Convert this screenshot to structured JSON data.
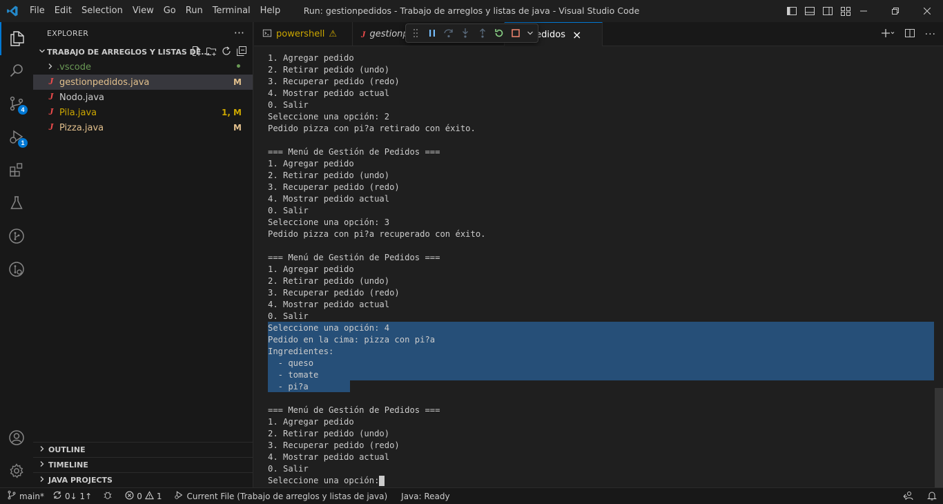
{
  "titlebar": {
    "menu": [
      "File",
      "Edit",
      "Selection",
      "View",
      "Go",
      "Run",
      "Terminal",
      "Help"
    ],
    "title": "Run: gestionpedidos - Trabajo de arreglos y listas de java - Visual Studio Code"
  },
  "activitybar": {
    "source_control_badge": "4",
    "run_debug_badge": "1"
  },
  "explorer": {
    "header": "EXPLORER",
    "folder_name": "TRABAJO DE ARREGLOS Y LISTAS DE...",
    "files": [
      {
        "icon": "J",
        "name": ".vscode",
        "status": "•",
        "kind": "folder",
        "color": "#6a9955"
      },
      {
        "icon": "J",
        "name": "gestionpedidos.java",
        "status": "M",
        "kind": "java",
        "color": "#e2c08d"
      },
      {
        "icon": "J",
        "name": "Nodo.java",
        "status": "",
        "kind": "java",
        "color": "#cccccc"
      },
      {
        "icon": "J",
        "name": "Pila.java",
        "status": "1, M",
        "kind": "java",
        "color": "#cca700"
      },
      {
        "icon": "J",
        "name": "Pizza.java",
        "status": "M",
        "kind": "java",
        "color": "#e2c08d"
      }
    ],
    "sections": [
      "OUTLINE",
      "TIMELINE",
      "JAVA PROJECTS"
    ]
  },
  "tabs": {
    "items": [
      {
        "label": "powershell",
        "warning": "⚠"
      },
      {
        "label": "gestionp",
        "icon": "J"
      },
      {
        "label": "tionpedidos",
        "close": "×"
      }
    ]
  },
  "terminal": {
    "lines": [
      "1. Agregar pedido",
      "2. Retirar pedido (undo)",
      "3. Recuperar pedido (redo)",
      "4. Mostrar pedido actual",
      "0. Salir",
      "Seleccione una opción: 2",
      "Pedido pizza con pi?a retirado con éxito.",
      "",
      "=== Menú de Gestión de Pedidos ===",
      "1. Agregar pedido",
      "2. Retirar pedido (undo)",
      "3. Recuperar pedido (redo)",
      "4. Mostrar pedido actual",
      "0. Salir",
      "Seleccione una opción: 3",
      "Pedido pizza con pi?a recuperado con éxito.",
      "",
      "=== Menú de Gestión de Pedidos ===",
      "1. Agregar pedido",
      "2. Retirar pedido (undo)",
      "3. Recuperar pedido (redo)",
      "4. Mostrar pedido actual",
      "0. Salir",
      "Seleccione una opción: 4",
      "Pedido en la cima: pizza con pi?a",
      "Ingredientes:",
      "  - queso",
      "  - tomate",
      "  - pi?a",
      "",
      "=== Menú de Gestión de Pedidos ===",
      "1. Agregar pedido",
      "2. Retirar pedido (undo)",
      "3. Recuperar pedido (redo)",
      "4. Mostrar pedido actual",
      "0. Salir",
      "Seleccione una opción: "
    ],
    "selection_color": "#264f78"
  },
  "statusbar": {
    "branch": "main*",
    "sync": "0↓ 1↑",
    "problems_errors": "0",
    "problems_warnings": "1",
    "current_file": "Current File (Trabajo de arreglos y listas de java)",
    "java_status": "Java: Ready"
  },
  "colors": {
    "accent": "#0078d4",
    "java_icon": "#f14c4c"
  }
}
